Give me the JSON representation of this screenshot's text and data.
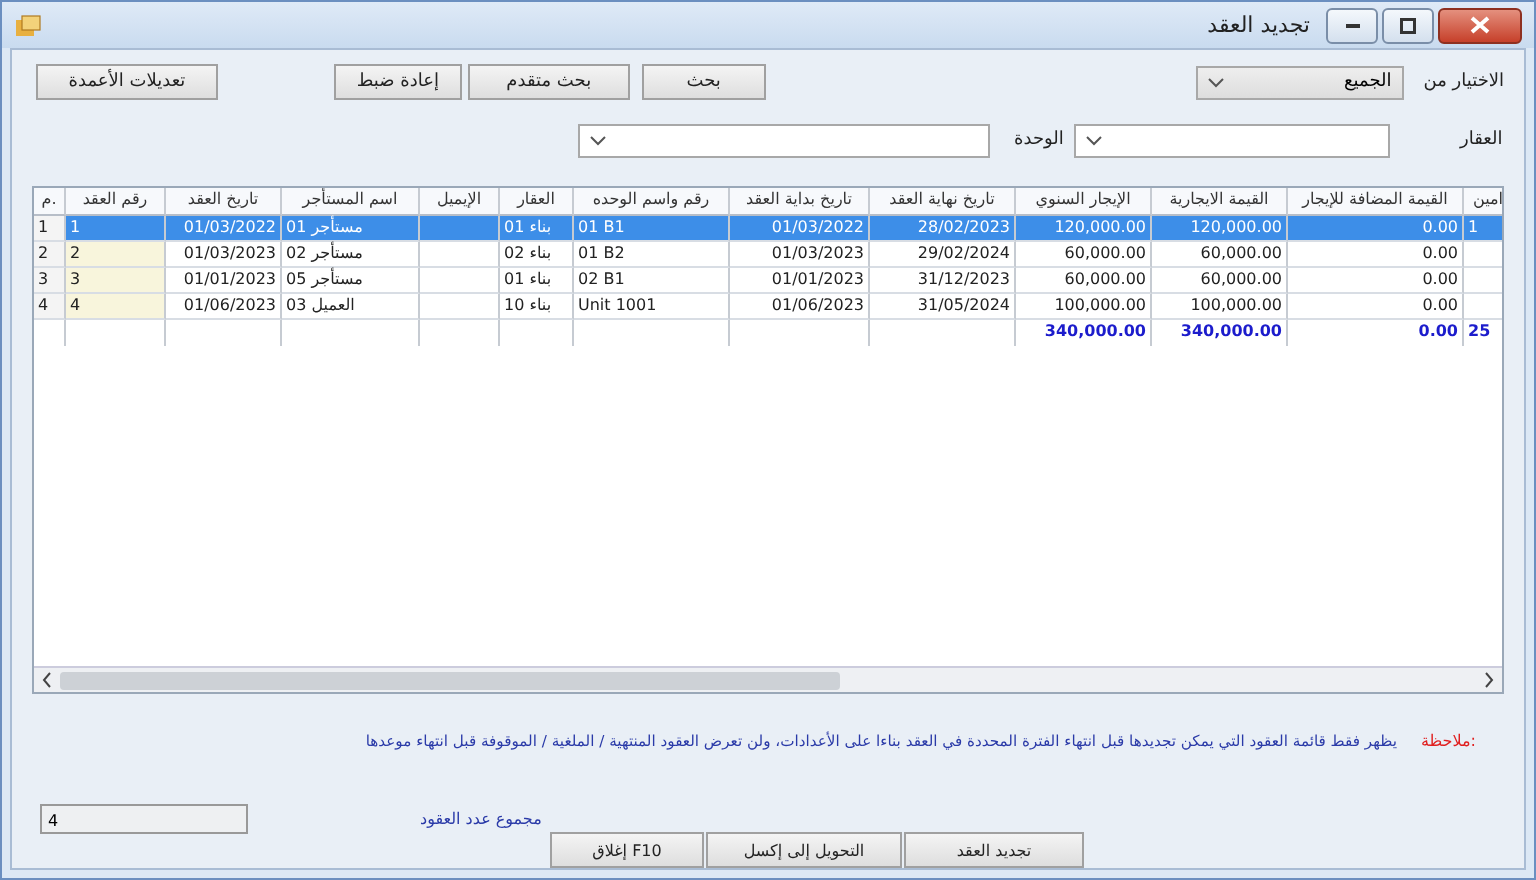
{
  "window": {
    "title": "تجديد العقد"
  },
  "toolbar": {
    "buttons": [
      "بحث",
      "بحث متقدم",
      "إعادة ضبط",
      "تعديلات الأعمدة"
    ]
  },
  "filters": {
    "choose_from": {
      "label": "الاختيار من",
      "value": "الجميع"
    },
    "property": {
      "label": "العقار"
    },
    "unit": {
      "label": "الوحدة"
    }
  },
  "table": {
    "columns": [
      {
        "label": "امين",
        "kind": "text"
      },
      {
        "label": "القيمة المضافة للإيجار",
        "kind": "number"
      },
      {
        "label": "القيمة الايجارية",
        "kind": "number"
      },
      {
        "label": "الإيجار السنوي",
        "kind": "number"
      },
      {
        "label": "تاريخ نهاية العقد",
        "kind": "number"
      },
      {
        "label": "تاريخ بداية العقد",
        "kind": "number"
      },
      {
        "label": "رقم واسم الوحده",
        "kind": "text"
      },
      {
        "label": "العقار",
        "kind": "text"
      },
      {
        "label": "الإيميل",
        "kind": "text"
      },
      {
        "label": "اسم المستأجر",
        "kind": "text"
      },
      {
        "label": "تاريخ العقد",
        "kind": "number"
      },
      {
        "label": "رقم العقد",
        "kind": "key"
      },
      {
        "label": "م.",
        "kind": "index"
      }
    ],
    "rows": [
      {
        "selected": true,
        "cells": [
          "1",
          "0.00",
          "120,000.00",
          "120,000.00",
          "28/02/2023",
          "01/03/2022",
          "01 B1",
          "بناء 01",
          null,
          "مستأجر 01",
          "01/03/2022",
          "1",
          "1"
        ]
      },
      {
        "selected": false,
        "cells": [
          null,
          "0.00",
          "60,000.00",
          "60,000.00",
          "29/02/2024",
          "01/03/2023",
          "01 B2",
          "بناء 02",
          null,
          "مستأجر 02",
          "01/03/2023",
          "2",
          "2"
        ]
      },
      {
        "selected": false,
        "cells": [
          null,
          "0.00",
          "60,000.00",
          "60,000.00",
          "31/12/2023",
          "01/01/2023",
          "02 B1",
          "بناء 01",
          null,
          "مستأجر 05",
          "01/01/2023",
          "3",
          "3"
        ]
      },
      {
        "selected": false,
        "cells": [
          null,
          "0.00",
          "100,000.00",
          "100,000.00",
          "31/05/2024",
          "01/06/2023",
          "Unit 1001",
          "بناء 10",
          null,
          "العميل 03",
          "01/06/2023",
          "4",
          "4"
        ]
      }
    ],
    "totals": [
      "25",
      "0.00",
      "340,000.00",
      "340,000.00"
    ]
  },
  "note": {
    "label": "ملاحظة:",
    "text": "يظهر فقط قائمة العقود التي يمكن تجديدها قبل انتهاء الفترة المحددة في العقد بناءا على الأعدادات، ولن تعرض العقود المنتهية / الملغية / الموقوفة قبل انتهاء موعدها"
  },
  "total_count": {
    "label": "مجموع عدد العقود",
    "value": "4"
  },
  "buttons": [
    "تجديد العقد",
    "التحويل إلى إكسل",
    "إغلاق F10"
  ]
}
